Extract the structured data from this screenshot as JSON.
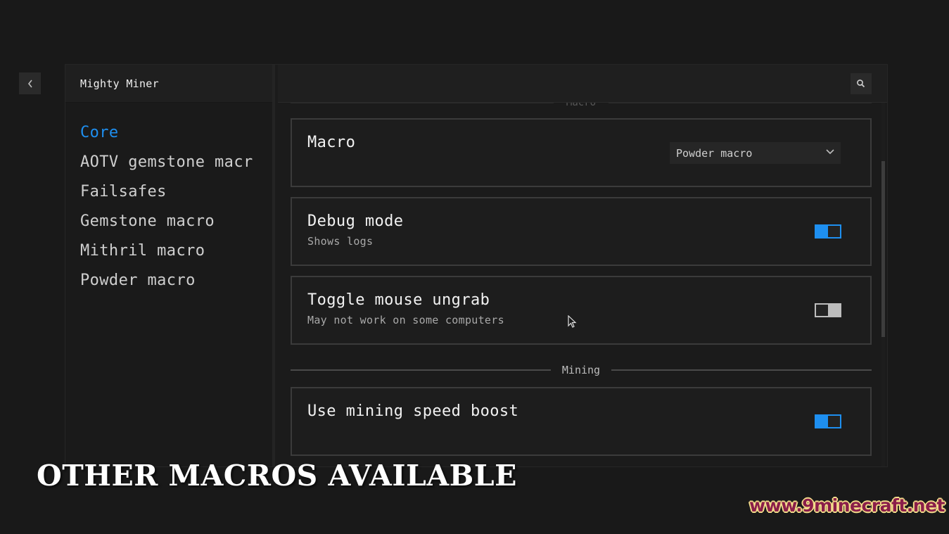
{
  "app": {
    "title": "Mighty Miner",
    "back_icon": "chevron-left-icon",
    "search_icon": "search-icon"
  },
  "sidebar": {
    "items": [
      {
        "label": "Core",
        "active": true
      },
      {
        "label": "AOTV gemstone macr",
        "active": false
      },
      {
        "label": "Failsafes",
        "active": false
      },
      {
        "label": "Gemstone macro",
        "active": false
      },
      {
        "label": "Mithril macro",
        "active": false
      },
      {
        "label": "Powder macro",
        "active": false
      }
    ]
  },
  "content": {
    "clipped_section_heading": "Macro",
    "settings": [
      {
        "title": "Macro",
        "description": "",
        "type": "dropdown",
        "value": "Powder macro"
      },
      {
        "title": "Debug mode",
        "description": "Shows logs",
        "type": "toggle",
        "enabled": true
      },
      {
        "title": "Toggle mouse ungrab",
        "description": "May not work on some computers",
        "type": "toggle",
        "enabled": false
      }
    ],
    "mining_section": {
      "heading": "Mining",
      "settings": [
        {
          "title": "Use mining speed boost",
          "description": "",
          "type": "toggle",
          "enabled": true
        }
      ]
    }
  },
  "overlay": {
    "caption": "OTHER MACROS AVAILABLE",
    "watermark": "www.9minecraft.net"
  },
  "colors": {
    "accent": "#1e8ff0",
    "background": "#191919",
    "card_border": "#3b3b3b",
    "toggle_off": "#bdbdbd",
    "watermark_fill": "#8a1e4a",
    "watermark_outline": "#f3dc8a"
  }
}
